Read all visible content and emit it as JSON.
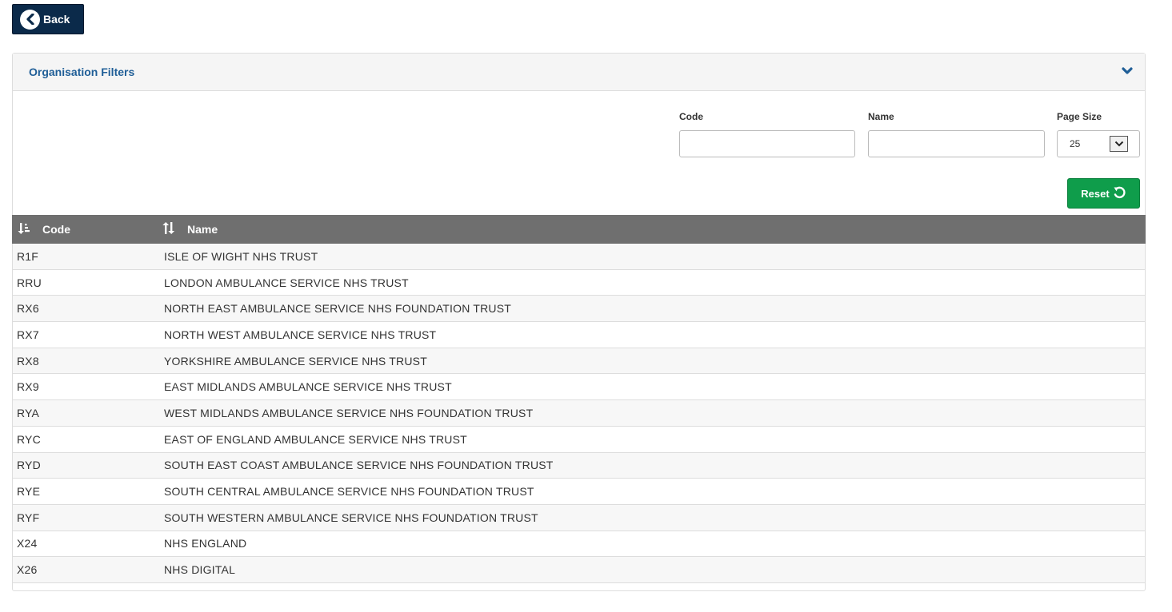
{
  "back_button": {
    "label": "Back",
    "icon": "chevron-left-circle-icon"
  },
  "filters_panel": {
    "title": "Organisation Filters",
    "toggle_icon": "chevron-down-icon",
    "code": {
      "label": "Code",
      "value": "",
      "placeholder": ""
    },
    "name": {
      "label": "Name",
      "value": "",
      "placeholder": ""
    },
    "page_size": {
      "label": "Page Size",
      "selected": "25"
    },
    "reset_label": "Reset"
  },
  "table": {
    "columns": [
      {
        "label": "Code",
        "sort_icon": "sort-ascending-icon"
      },
      {
        "label": "Name",
        "sort_icon": "sort-both-icon"
      }
    ],
    "rows": [
      {
        "code": "R1F",
        "name": "ISLE OF WIGHT NHS TRUST"
      },
      {
        "code": "RRU",
        "name": "LONDON AMBULANCE SERVICE NHS TRUST"
      },
      {
        "code": "RX6",
        "name": "NORTH EAST AMBULANCE SERVICE NHS FOUNDATION TRUST"
      },
      {
        "code": "RX7",
        "name": "NORTH WEST AMBULANCE SERVICE NHS TRUST"
      },
      {
        "code": "RX8",
        "name": "YORKSHIRE AMBULANCE SERVICE NHS TRUST"
      },
      {
        "code": "RX9",
        "name": "EAST MIDLANDS AMBULANCE SERVICE NHS TRUST"
      },
      {
        "code": "RYA",
        "name": "WEST MIDLANDS AMBULANCE SERVICE NHS FOUNDATION TRUST"
      },
      {
        "code": "RYC",
        "name": "EAST OF ENGLAND AMBULANCE SERVICE NHS TRUST"
      },
      {
        "code": "RYD",
        "name": "SOUTH EAST COAST AMBULANCE SERVICE NHS FOUNDATION TRUST"
      },
      {
        "code": "RYE",
        "name": "SOUTH CENTRAL AMBULANCE SERVICE NHS FOUNDATION TRUST"
      },
      {
        "code": "RYF",
        "name": "SOUTH WESTERN AMBULANCE SERVICE NHS FOUNDATION TRUST"
      },
      {
        "code": "X24",
        "name": "NHS ENGLAND"
      },
      {
        "code": "X26",
        "name": "NHS DIGITAL"
      }
    ]
  },
  "colors": {
    "back_button_bg": "#0b2a4a",
    "panel_title": "#1f5e97",
    "reset_button_bg": "#0f9d4b",
    "table_header_bg": "#6f6f6f"
  }
}
